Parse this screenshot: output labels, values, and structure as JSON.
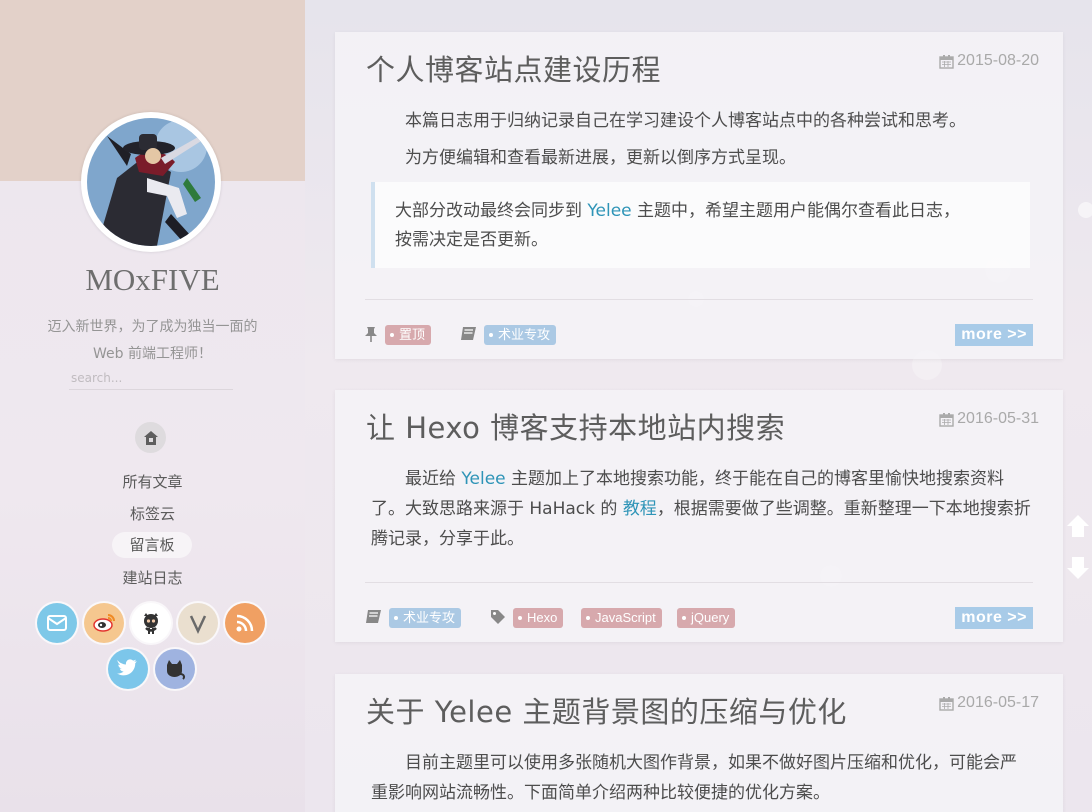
{
  "site": {
    "title": "MOxFIVE",
    "desc_line1": "迈入新世界，为了成为独当一面的",
    "desc_line2": "Web 前端工程师！",
    "search_placeholder": "search..."
  },
  "nav": [
    "所有文章",
    "标签云",
    "留言板",
    "建站日志"
  ],
  "social": [
    {
      "icon": "mail-icon",
      "color": "#7ec8e8"
    },
    {
      "icon": "weibo-icon",
      "color": "#f5c78f"
    },
    {
      "icon": "github-icon",
      "color": "#ffffff"
    },
    {
      "icon": "v2ex-icon",
      "color": "#eadfcf"
    },
    {
      "icon": "rss-icon",
      "color": "#f0a063"
    },
    {
      "icon": "twitter-icon",
      "color": "#7cc6ea"
    },
    {
      "icon": "cat-icon",
      "color": "#9fb3e0"
    }
  ],
  "posts": [
    {
      "title": "个人博客站点建设历程",
      "date": "2015-08-20",
      "p1": "本篇日志用于归纳记录自己在学习建设个人博客站点中的各种尝试和思考。",
      "p2": "为方便编辑和查看最新进展，更新以倒序方式呈现。",
      "quote_a": "大部分改动最终会同步到 ",
      "quote_link": "Yelee",
      "quote_b": " 主题中，希望主题用户能偶尔查看此日志，",
      "quote_c": "按需决定是否更新。",
      "tag_top": "置顶",
      "category": "术业专攻",
      "more": "more >>"
    },
    {
      "title": "让 Hexo 博客支持本地站内搜索",
      "date": "2016-05-31",
      "p_a": "最近给 ",
      "p_link1": "Yelee",
      "p_b": " 主题加上了本地搜索功能，终于能在自己的博客里愉快地搜索资料了。大致思路来源于 HaHack 的 ",
      "p_link2": "教程",
      "p_c": "，根据需要做了些调整。重新整理一下本地搜索折腾记录，分享于此。",
      "category": "术业专攻",
      "tags": [
        "Hexo",
        "JavaScript",
        "jQuery"
      ],
      "more": "more >>"
    },
    {
      "title": "关于 Yelee 主题背景图的压缩与优化",
      "date": "2016-05-17",
      "p1": "目前主题里可以使用多张随机大图作背景，如果不做好图片压缩和优化，可能会严重影响网站流畅性。下面简单介绍两种比较便捷的优化方案。"
    }
  ]
}
